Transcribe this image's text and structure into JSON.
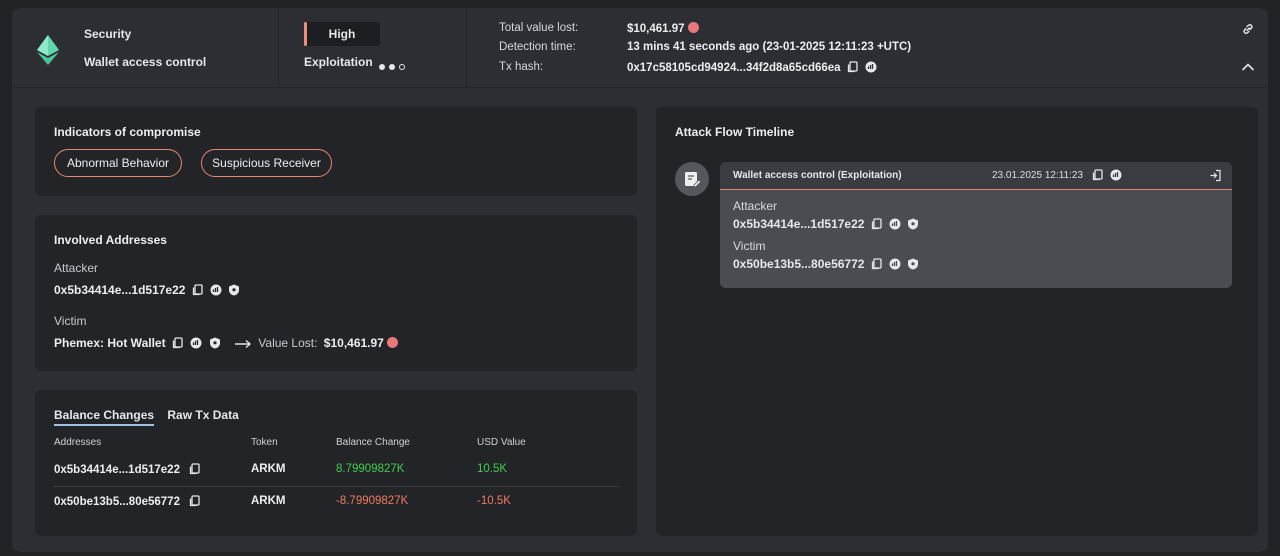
{
  "header": {
    "category": "Security",
    "incident_type": "Wallet access control",
    "severity": "High",
    "stage": "Exploitation",
    "stage_progress": [
      true,
      true,
      false
    ],
    "total_value_lost_label": "Total value lost:",
    "total_value_lost": "$10,461.97",
    "detection_time_label": "Detection time:",
    "detection_time": "13 mins 41 seconds ago (23-01-2025 12:11:23 +UTC)",
    "tx_hash_label": "Tx hash:",
    "tx_hash": "0x17c58105cd94924...34f2d8a65cd66ea"
  },
  "indicators": {
    "title": "Indicators of compromise",
    "chips": [
      "Abnormal Behavior",
      "Suspicious Receiver"
    ]
  },
  "involved": {
    "title": "Involved Addresses",
    "attacker_label": "Attacker",
    "attacker_address": "0x5b34414e...1d517e22",
    "victim_label": "Victim",
    "victim_name": "Phemex: Hot Wallet",
    "value_lost_label": "Value Lost:",
    "value_lost": "$10,461.97"
  },
  "balance": {
    "tabs": [
      "Balance Changes",
      "Raw Tx Data"
    ],
    "columns": [
      "Addresses",
      "Token",
      "Balance Change",
      "USD Value"
    ],
    "rows": [
      {
        "address": "0x5b34414e...1d517e22",
        "token": "ARKM",
        "change": "8.79909827K",
        "usd": "10.5K"
      },
      {
        "address": "0x50be13b5...80e56772",
        "token": "ARKM",
        "change": "-8.79909827K",
        "usd": "-10.5K"
      }
    ]
  },
  "timeline": {
    "title": "Attack Flow Timeline",
    "event_title": "Wallet access control  (Exploitation)",
    "event_time": "23.01.2025 12:11:23",
    "attacker_label": "Attacker",
    "attacker_address": "0x5b34414e...1d517e22",
    "victim_label": "Victim",
    "victim_address": "0x50be13b5...80e56772"
  },
  "colors": {
    "accent": "#e8866e",
    "positive": "#3fcf4a",
    "negative": "#ef7a5e"
  }
}
